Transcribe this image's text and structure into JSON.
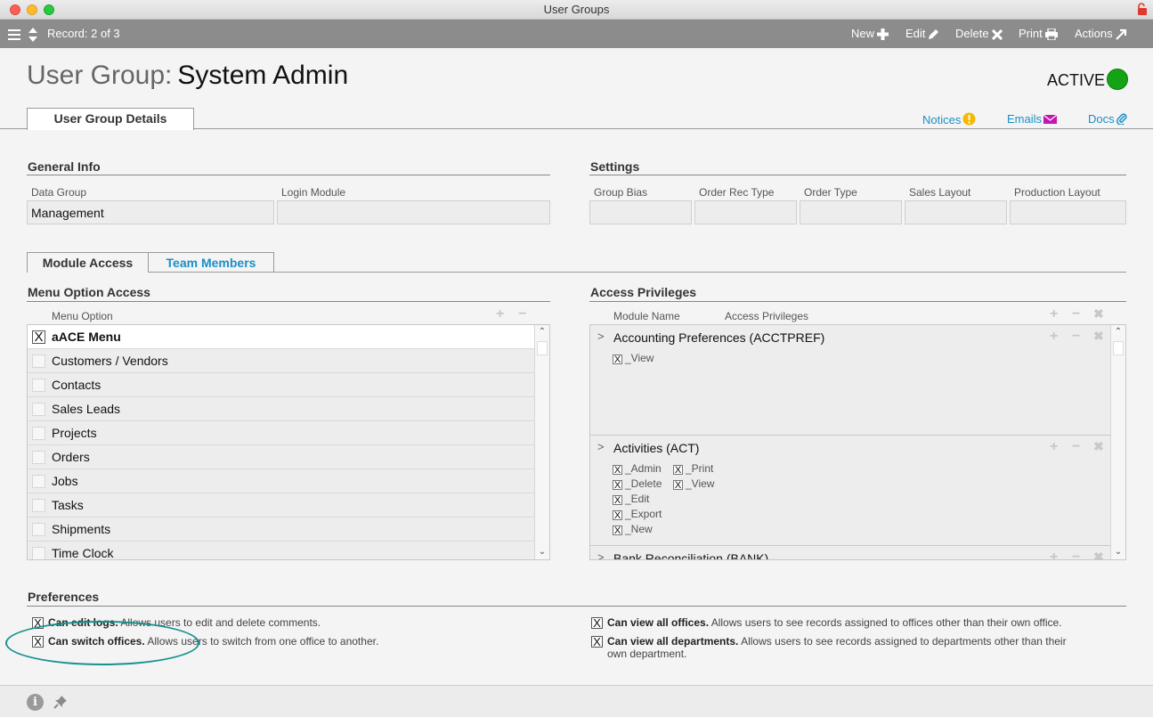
{
  "window": {
    "title": "User Groups"
  },
  "toolbar": {
    "record_label": "Record: 2 of 3",
    "new_label": "New",
    "edit_label": "Edit",
    "delete_label": "Delete",
    "print_label": "Print",
    "actions_label": "Actions"
  },
  "header": {
    "prefix": "User Group:",
    "name": "System Admin",
    "status": "ACTIVE",
    "status_color": "#14a314"
  },
  "tabs": {
    "main": "User Group Details"
  },
  "links": {
    "notices": "Notices",
    "emails": "Emails",
    "docs": "Docs"
  },
  "general_info": {
    "title": "General Info",
    "data_group_label": "Data Group",
    "data_group_value": "Management",
    "login_module_label": "Login Module",
    "login_module_value": ""
  },
  "settings": {
    "title": "Settings",
    "fields": [
      {
        "label": "Group Bias",
        "value": ""
      },
      {
        "label": "Order Rec Type",
        "value": ""
      },
      {
        "label": "Order Type",
        "value": ""
      },
      {
        "label": "Sales Layout",
        "value": ""
      },
      {
        "label": "Production Layout",
        "value": ""
      }
    ]
  },
  "sub_tabs": {
    "module_access": "Module Access",
    "team_members": "Team Members"
  },
  "menu_access": {
    "title": "Menu Option Access",
    "column": "Menu Option",
    "plus": "+",
    "minus": "−",
    "items": [
      {
        "label": "aACE Menu",
        "checked": true,
        "mark": "X"
      },
      {
        "label": "Customers / Vendors",
        "checked": false,
        "mark": ""
      },
      {
        "label": "Contacts",
        "checked": false,
        "mark": ""
      },
      {
        "label": "Sales Leads",
        "checked": false,
        "mark": ""
      },
      {
        "label": "Projects",
        "checked": false,
        "mark": ""
      },
      {
        "label": "Orders",
        "checked": false,
        "mark": ""
      },
      {
        "label": "Jobs",
        "checked": false,
        "mark": ""
      },
      {
        "label": "Tasks",
        "checked": false,
        "mark": ""
      },
      {
        "label": "Shipments",
        "checked": false,
        "mark": ""
      },
      {
        "label": "Time Clock",
        "checked": false,
        "mark": ""
      }
    ]
  },
  "access_privileges": {
    "title": "Access Privileges",
    "col_module": "Module Name",
    "col_privileges": "Access Privileges",
    "plus": "+",
    "minus": "−",
    "close": "✖",
    "arrow": ">",
    "modules": [
      {
        "name": "Accounting Preferences  (ACCTPREF)",
        "perms": [
          "_View"
        ]
      },
      {
        "name": "Activities  (ACT)",
        "perms": [
          "_Admin",
          "_Delete",
          "_Edit",
          "_Export",
          "_New",
          "_Print",
          "_View"
        ]
      },
      {
        "name": "Bank Reconciliation  (BANK)",
        "perms": []
      }
    ]
  },
  "preferences": {
    "title": "Preferences",
    "check_mark": "X",
    "items": [
      {
        "bold": "Can edit logs.",
        "text": " Allows users to edit and delete comments.",
        "checked": true
      },
      {
        "bold": "Can switch offices.",
        "text": " Allows users to switch from one office to another.",
        "checked": true
      },
      {
        "bold": "Can view all offices.",
        "text": " Allows users to see records assigned to offices other than their own office.",
        "checked": true
      },
      {
        "bold": "Can view all departments.",
        "text": " Allows users to see records assigned to departments other than their",
        "text2": "own department.",
        "checked": true
      }
    ]
  },
  "footer": {
    "info_glyph": "i"
  }
}
